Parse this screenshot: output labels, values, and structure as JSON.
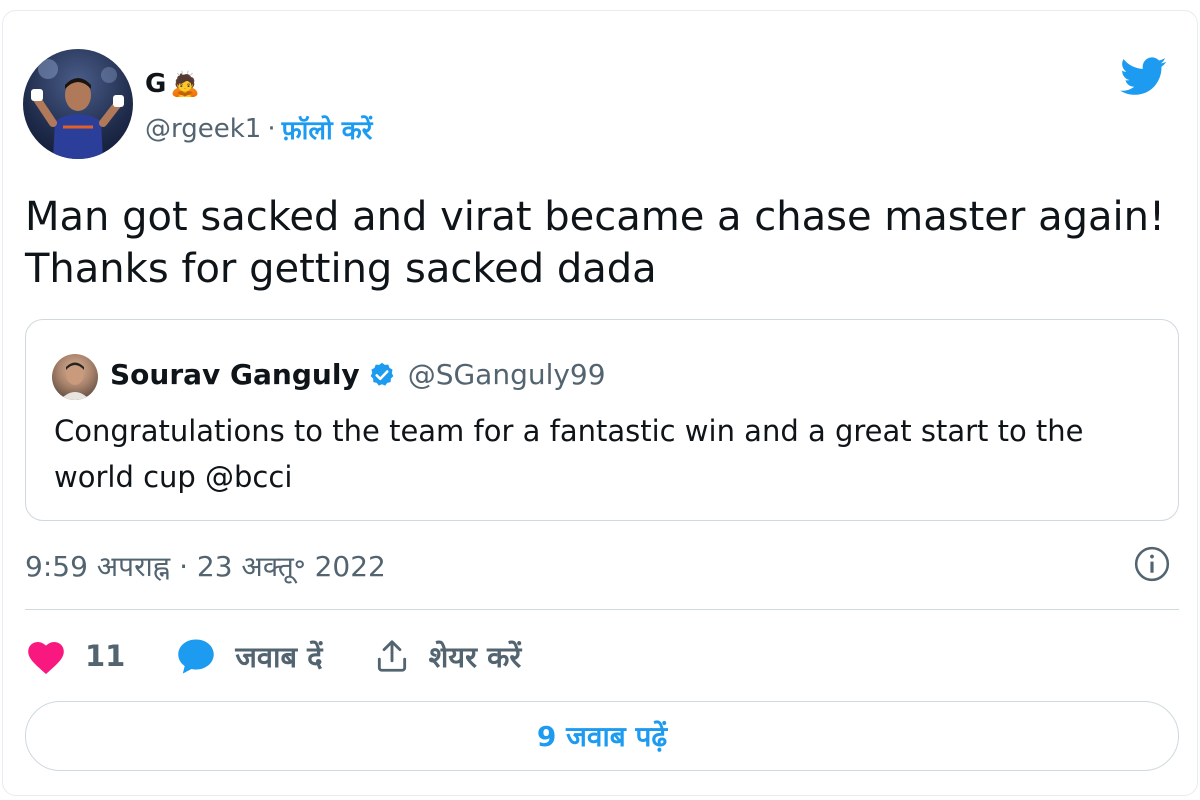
{
  "tweet": {
    "display_name": "G",
    "name_emoji": "🙇",
    "handle": "@rgeek1",
    "separator": "·",
    "follow_label": "फ़ॉलो करें",
    "text_line1": "Man got sacked and virat became a chase master again!",
    "text_line2": "Thanks for getting sacked dada"
  },
  "quoted_tweet": {
    "name": "Sourav Ganguly",
    "handle": "@SGanguly99",
    "text_line1": "Congratulations to the team for a fantastic win and a great start to the",
    "text_line2": "world cup @bcci"
  },
  "meta": {
    "timestamp": "9:59 अपराह्न · 23 अक्तू॰ 2022"
  },
  "actions": {
    "like_count": "11",
    "reply_label": "जवाब दें",
    "share_label": "शेयर करें"
  },
  "read_replies_label": "9 जवाब पढ़ें",
  "colors": {
    "accent": "#1d9bf0",
    "like": "#f91880",
    "text": "#0f1419",
    "muted": "#536471",
    "border": "#cfd9de"
  },
  "icons": {
    "brand": "twitter-bird-icon",
    "verified": "verified-badge-icon",
    "info": "info-icon",
    "like": "heart-icon",
    "reply": "speech-bubble-icon",
    "share": "share-icon"
  }
}
